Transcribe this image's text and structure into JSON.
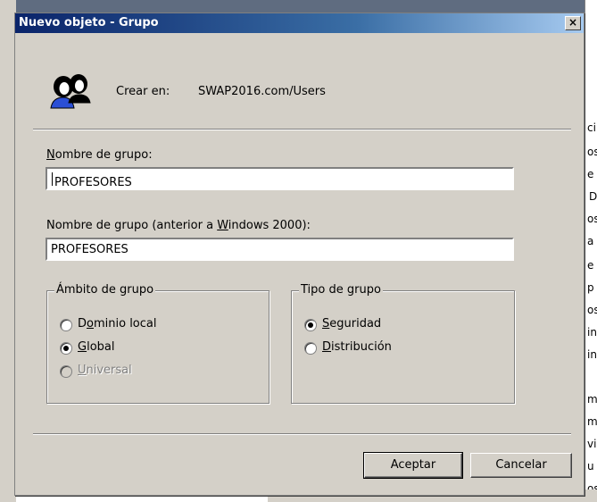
{
  "background": {
    "right_fragments": [
      "ci",
      "os",
      "e",
      "D",
      "os",
      "a",
      "e",
      "p",
      "os",
      "in",
      "in",
      "m",
      "m",
      "vi",
      "u",
      "os"
    ]
  },
  "dialog": {
    "title": "Nuevo objeto - Grupo",
    "close_glyph": "×",
    "create_in_label": "Crear en:",
    "create_in_value": "SWAP2016.com/Users",
    "group_name_label": {
      "pre": "",
      "key": "N",
      "post": "ombre de grupo:"
    },
    "group_name_value": "PROFESORES",
    "legacy_name_label": {
      "pre": "Nombre de grupo (anterior a ",
      "key": "W",
      "post": "indows 2000):"
    },
    "legacy_name_value": "PROFESORES",
    "scope": {
      "title": "Ámbito de grupo",
      "options": [
        {
          "pre": "D",
          "key": "o",
          "post": "minio local",
          "checked": false,
          "disabled": false
        },
        {
          "pre": "",
          "key": "G",
          "post": "lobal",
          "checked": true,
          "disabled": false
        },
        {
          "pre": "",
          "key": "U",
          "post": "niversal",
          "checked": false,
          "disabled": true
        }
      ]
    },
    "type": {
      "title": "Tipo de grupo",
      "options": [
        {
          "pre": "",
          "key": "S",
          "post": "eguridad",
          "checked": true
        },
        {
          "pre": "",
          "key": "D",
          "post": "istribución",
          "checked": false
        }
      ]
    },
    "ok_label": "Aceptar",
    "cancel_label": "Cancelar"
  },
  "icons": {
    "group": "group-users-icon",
    "close": "close-icon"
  },
  "colors": {
    "titlebar_start": "#0a246a",
    "titlebar_end": "#a6caf0",
    "face": "#d4d0c8"
  }
}
